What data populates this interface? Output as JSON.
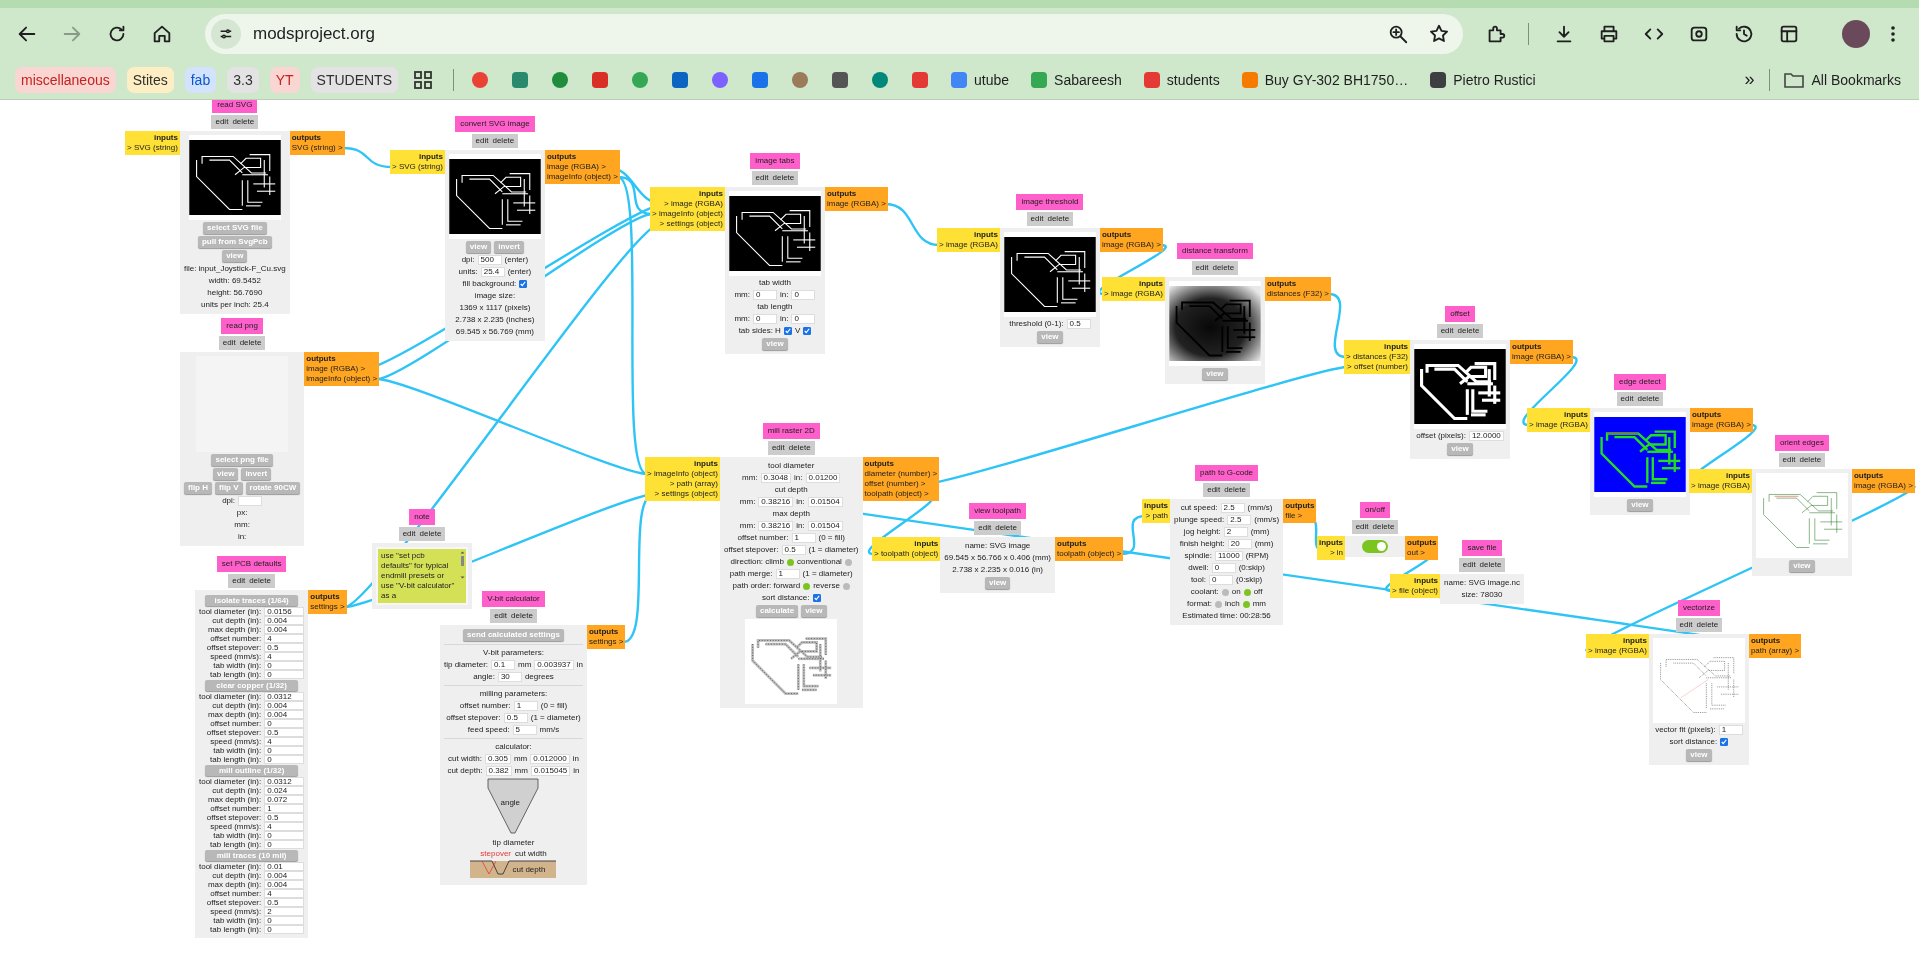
{
  "nav_buttons": [
    {
      "kind": "back",
      "disabled": false
    },
    {
      "kind": "forward",
      "disabled": true
    },
    {
      "kind": "reload",
      "disabled": false
    },
    {
      "kind": "home",
      "disabled": false
    }
  ],
  "address_bar": {
    "url": "modsproject.org"
  },
  "bookmarks": [
    {
      "kind": "chip",
      "label": "miscellaneous",
      "color": "#f9d6d2"
    },
    {
      "kind": "chip",
      "label": "Stites",
      "color": "#fdefc3"
    },
    {
      "kind": "chip",
      "label": "fab",
      "color": "#d3e3fd"
    },
    {
      "kind": "chip",
      "label": "3.3",
      "color": "#e3e3e3"
    },
    {
      "kind": "chip",
      "label": "YT",
      "color": "#f9d6d2"
    },
    {
      "kind": "chip",
      "label": "STUDENTS",
      "color": "#e3e3e3"
    },
    {
      "kind": "apps"
    },
    {
      "kind": "favicon",
      "color": "#ea4335"
    },
    {
      "kind": "favicon",
      "color": "#2b8a6e"
    },
    {
      "kind": "favicon",
      "color": "#1e8e3e"
    },
    {
      "kind": "favicon",
      "color": "#d93025"
    },
    {
      "kind": "favicon",
      "color": "#34a853"
    },
    {
      "kind": "favicon",
      "color": "#0a66c2"
    },
    {
      "kind": "favicon",
      "color": "#7b61ff"
    },
    {
      "kind": "favicon",
      "color": "#1a73e8"
    },
    {
      "kind": "favicon",
      "color": "#9a7b5a"
    },
    {
      "kind": "favicon",
      "color": "#555555"
    },
    {
      "kind": "favicon",
      "color": "#00897b"
    },
    {
      "kind": "favicon",
      "color": "#e53935"
    },
    {
      "kind": "link",
      "label": "utube",
      "color": "#4285f4"
    },
    {
      "kind": "link",
      "label": "Sabareesh",
      "color": "#34a853"
    },
    {
      "kind": "link",
      "label": "students",
      "color": "#e53935"
    },
    {
      "kind": "link",
      "label": "Buy GY-302 BH1750…",
      "color": "#f57c00"
    },
    {
      "kind": "link",
      "label": "Pietro Rustici",
      "color": "#3c4043"
    }
  ],
  "bookmarks_overflow": "»",
  "all_bookmarks": "All Bookmarks",
  "modules": [
    {
      "title": "read SVG",
      "actions": [
        "edit",
        "delete"
      ],
      "inputs": {
        "label": "inputs",
        "ports": [
          "> SVG (string)"
        ]
      },
      "outputs": {
        "label": "outputs",
        "ports": [
          "SVG (string) >"
        ]
      },
      "body": [
        {
          "kind": "pcb_image"
        },
        {
          "kind": "buttons",
          "labels": [
            "select SVG file"
          ]
        },
        {
          "kind": "buttons",
          "labels": [
            "pull from SvgPcb"
          ]
        },
        {
          "kind": "buttons",
          "labels": [
            "view"
          ]
        },
        {
          "kind": "text",
          "text": "file: input_Joystick-F_Cu.svg"
        },
        {
          "kind": "text",
          "text": "width: 69.5452"
        },
        {
          "kind": "text",
          "text": "height: 56.7690"
        },
        {
          "kind": "text",
          "text": "units per inch: 25.4"
        }
      ]
    },
    {
      "title": "read png",
      "actions": [
        "edit",
        "delete"
      ],
      "outputs": {
        "label": "outputs",
        "ports": [
          "image (RGBA) >",
          "imageInfo (object) >"
        ]
      },
      "body": [
        {
          "kind": "blank_image"
        },
        {
          "kind": "buttons",
          "labels": [
            "select png file"
          ]
        },
        {
          "kind": "buttons",
          "labels": [
            "view",
            "invert"
          ]
        },
        {
          "kind": "buttons",
          "labels": [
            "flip H",
            "flip V",
            "rotate 90CW"
          ]
        },
        {
          "kind": "row",
          "parts": [
            {
              "kind": "label",
              "text": "dpi:"
            },
            {
              "kind": "input"
            }
          ]
        },
        {
          "kind": "text",
          "text": "px:"
        },
        {
          "kind": "text",
          "text": "mm:"
        },
        {
          "kind": "text",
          "text": "in:"
        }
      ]
    },
    {
      "title": "set PCB defaults",
      "actions": [
        "edit",
        "delete"
      ],
      "outputs": {
        "label": "outputs",
        "ports": [
          "settings >"
        ]
      },
      "body": [
        {
          "kind": "header_button",
          "label": "isolate traces (1/64)"
        },
        {
          "kind": "row",
          "parts": [
            {
              "kind": "label",
              "text": "tool diameter (in):"
            },
            {
              "kind": "input",
              "value": "0.0156"
            }
          ]
        },
        {
          "kind": "row",
          "parts": [
            {
              "kind": "label",
              "text": "cut depth (in):"
            },
            {
              "kind": "input",
              "value": "0.004"
            }
          ]
        },
        {
          "kind": "row",
          "parts": [
            {
              "kind": "label",
              "text": "max depth (in):"
            },
            {
              "kind": "input",
              "value": "0.004"
            }
          ]
        },
        {
          "kind": "row",
          "parts": [
            {
              "kind": "label",
              "text": "offset number:"
            },
            {
              "kind": "input",
              "value": "4"
            }
          ]
        },
        {
          "kind": "row",
          "parts": [
            {
              "kind": "label",
              "text": "offset stepover:"
            },
            {
              "kind": "input",
              "value": "0.5"
            }
          ]
        },
        {
          "kind": "row",
          "parts": [
            {
              "kind": "label",
              "text": "speed (mm/s):"
            },
            {
              "kind": "input",
              "value": "4"
            }
          ]
        },
        {
          "kind": "row",
          "parts": [
            {
              "kind": "label",
              "text": "tab width (in):"
            },
            {
              "kind": "input",
              "value": "0"
            }
          ]
        },
        {
          "kind": "row",
          "parts": [
            {
              "kind": "label",
              "text": "tab length (in):"
            },
            {
              "kind": "input",
              "value": "0"
            }
          ]
        },
        {
          "kind": "header_button",
          "label": "clear copper (1/32)"
        },
        {
          "kind": "row",
          "parts": [
            {
              "kind": "label",
              "text": "tool diameter (in):"
            },
            {
              "kind": "input",
              "value": "0.0312"
            }
          ]
        },
        {
          "kind": "row",
          "parts": [
            {
              "kind": "label",
              "text": "cut depth (in):"
            },
            {
              "kind": "input",
              "value": "0.004"
            }
          ]
        },
        {
          "kind": "row",
          "parts": [
            {
              "kind": "label",
              "text": "max depth (in):"
            },
            {
              "kind": "input",
              "value": "0.004"
            }
          ]
        },
        {
          "kind": "row",
          "parts": [
            {
              "kind": "label",
              "text": "offset number:"
            },
            {
              "kind": "input",
              "value": "0"
            }
          ]
        },
        {
          "kind": "row",
          "parts": [
            {
              "kind": "label",
              "text": "offset stepover:"
            },
            {
              "kind": "input",
              "value": "0.5"
            }
          ]
        },
        {
          "kind": "row",
          "parts": [
            {
              "kind": "label",
              "text": "speed (mm/s):"
            },
            {
              "kind": "input",
              "value": "4"
            }
          ]
        },
        {
          "kind": "row",
          "parts": [
            {
              "kind": "label",
              "text": "tab width (in):"
            },
            {
              "kind": "input",
              "value": "0"
            }
          ]
        },
        {
          "kind": "row",
          "parts": [
            {
              "kind": "label",
              "text": "tab length (in):"
            },
            {
              "kind": "input",
              "value": "0"
            }
          ]
        },
        {
          "kind": "header_button",
          "label": "mill outline (1/32)"
        },
        {
          "kind": "row",
          "parts": [
            {
              "kind": "label",
              "text": "tool diameter (in):"
            },
            {
              "kind": "input",
              "value": "0.0312"
            }
          ]
        },
        {
          "kind": "row",
          "parts": [
            {
              "kind": "label",
              "text": "cut depth (in):"
            },
            {
              "kind": "input",
              "value": "0.024"
            }
          ]
        },
        {
          "kind": "row",
          "parts": [
            {
              "kind": "label",
              "text": "max depth (in):"
            },
            {
              "kind": "input",
              "value": "0.072"
            }
          ]
        },
        {
          "kind": "row",
          "parts": [
            {
              "kind": "label",
              "text": "offset number:"
            },
            {
              "kind": "input",
              "value": "1"
            }
          ]
        },
        {
          "kind": "row",
          "parts": [
            {
              "kind": "label",
              "text": "offset stepover:"
            },
            {
              "kind": "input",
              "value": "0.5"
            }
          ]
        },
        {
          "kind": "row",
          "parts": [
            {
              "kind": "label",
              "text": "speed (mm/s):"
            },
            {
              "kind": "input",
              "value": "4"
            }
          ]
        },
        {
          "kind": "row",
          "parts": [
            {
              "kind": "label",
              "text": "tab width (in):"
            },
            {
              "kind": "input",
              "value": "0"
            }
          ]
        },
        {
          "kind": "row",
          "parts": [
            {
              "kind": "label",
              "text": "tab length (in):"
            },
            {
              "kind": "input",
              "value": "0"
            }
          ]
        },
        {
          "kind": "header_button",
          "label": "mill traces (10 mil)"
        },
        {
          "kind": "row",
          "parts": [
            {
              "kind": "label",
              "text": "tool diameter (in):"
            },
            {
              "kind": "input",
              "value": "0.01"
            }
          ]
        },
        {
          "kind": "row",
          "parts": [
            {
              "kind": "label",
              "text": "cut depth (in):"
            },
            {
              "kind": "input",
              "value": "0.004"
            }
          ]
        },
        {
          "kind": "row",
          "parts": [
            {
              "kind": "label",
              "text": "max depth (in):"
            },
            {
              "kind": "input",
              "value": "0.004"
            }
          ]
        },
        {
          "kind": "row",
          "parts": [
            {
              "kind": "label",
              "text": "offset number:"
            },
            {
              "kind": "input",
              "value": "4"
            }
          ]
        },
        {
          "kind": "row",
          "parts": [
            {
              "kind": "label",
              "text": "offset stepover:"
            },
            {
              "kind": "input",
              "value": "0.5"
            }
          ]
        },
        {
          "kind": "row",
          "parts": [
            {
              "kind": "label",
              "text": "speed (mm/s):"
            },
            {
              "kind": "input",
              "value": "2"
            }
          ]
        },
        {
          "kind": "row",
          "parts": [
            {
              "kind": "label",
              "text": "tab width (in):"
            },
            {
              "kind": "input",
              "value": "0"
            }
          ]
        },
        {
          "kind": "row",
          "parts": [
            {
              "kind": "label",
              "text": "tab length (in):"
            },
            {
              "kind": "input",
              "value": "0"
            }
          ]
        }
      ]
    },
    {
      "title": "convert SVG image",
      "actions": [
        "edit",
        "delete"
      ],
      "inputs": {
        "label": "inputs",
        "ports": [
          "> SVG (string)"
        ]
      },
      "outputs": {
        "label": "outputs",
        "ports": [
          "image (RGBA) >",
          "imageInfo (object) >"
        ]
      },
      "body": [
        {
          "kind": "pcb_image"
        },
        {
          "kind": "buttons",
          "labels": [
            "view",
            "invert"
          ]
        },
        {
          "kind": "row",
          "parts": [
            {
              "kind": "label",
              "text": "dpi:"
            },
            {
              "kind": "input",
              "value": "500"
            },
            {
              "kind": "label",
              "text": "(enter)"
            }
          ]
        },
        {
          "kind": "row",
          "parts": [
            {
              "kind": "label",
              "text": "units:"
            },
            {
              "kind": "input",
              "value": "25.4"
            },
            {
              "kind": "label",
              "text": "(enter)"
            }
          ]
        },
        {
          "kind": "row",
          "parts": [
            {
              "kind": "label",
              "text": "fill background:"
            },
            {
              "kind": "checkbox",
              "checked": true
            }
          ]
        },
        {
          "kind": "text",
          "text": "image size:"
        },
        {
          "kind": "text",
          "text": "1369 x 1117 (pixels)"
        },
        {
          "kind": "text",
          "text": "2.738 x 2.235 (inches)"
        },
        {
          "kind": "text",
          "text": "69.545 x 56.769 (mm)"
        }
      ]
    },
    {
      "title": "note",
      "actions": [
        "edit",
        "delete"
      ],
      "body": [
        {
          "kind": "textarea",
          "text": "use \"set pcb defaults\" for typical endmill presets or use \"V-bit calculator\" as a"
        }
      ]
    },
    {
      "title": "V-bit calculator",
      "actions": [
        "edit",
        "delete"
      ],
      "outputs": {
        "label": "outputs",
        "ports": [
          "settings >"
        ]
      },
      "body": [
        {
          "kind": "buttons",
          "labels": [
            "send calculated settings"
          ]
        },
        {
          "kind": "rule"
        },
        {
          "kind": "text",
          "text": "V-bit parameters:"
        },
        {
          "kind": "row",
          "parts": [
            {
              "kind": "label",
              "text": "tip diameter:"
            },
            {
              "kind": "input",
              "value": "0.1"
            },
            {
              "kind": "label",
              "text": "mm"
            },
            {
              "kind": "input",
              "value": "0.003937"
            },
            {
              "kind": "label",
              "text": "in"
            }
          ]
        },
        {
          "kind": "row",
          "parts": [
            {
              "kind": "label",
              "text": "angle:"
            },
            {
              "kind": "input",
              "value": "30"
            },
            {
              "kind": "label",
              "text": "degrees"
            }
          ]
        },
        {
          "kind": "rule"
        },
        {
          "kind": "text",
          "text": "milling parameters:"
        },
        {
          "kind": "row",
          "parts": [
            {
              "kind": "label",
              "text": "offset number:"
            },
            {
              "kind": "input",
              "value": "1"
            },
            {
              "kind": "label",
              "text": "(0 = fill)"
            }
          ]
        },
        {
          "kind": "row",
          "parts": [
            {
              "kind": "label",
              "text": "offset stepover:"
            },
            {
              "kind": "input",
              "value": "0.5"
            },
            {
              "kind": "label",
              "text": "(1 = diameter)"
            }
          ]
        },
        {
          "kind": "row",
          "parts": [
            {
              "kind": "label",
              "text": "feed speed:"
            },
            {
              "kind": "input",
              "value": "5"
            },
            {
              "kind": "label",
              "text": "mm/s"
            }
          ]
        },
        {
          "kind": "rule"
        },
        {
          "kind": "text",
          "text": "calculator:"
        },
        {
          "kind": "row",
          "parts": [
            {
              "kind": "label",
              "text": "cut width:"
            },
            {
              "kind": "input",
              "value": "0.305"
            },
            {
              "kind": "label",
              "text": "mm"
            },
            {
              "kind": "input",
              "value": "0.012000"
            },
            {
              "kind": "label",
              "text": "in"
            }
          ]
        },
        {
          "kind": "row",
          "parts": [
            {
              "kind": "label",
              "text": "cut depth:"
            },
            {
              "kind": "input",
              "value": "0.382"
            },
            {
              "kind": "label",
              "text": "mm"
            },
            {
              "kind": "input",
              "value": "0.015045"
            },
            {
              "kind": "label",
              "text": "in"
            }
          ]
        },
        {
          "kind": "vbit",
          "angle_label": "angle",
          "tip_label": "tip diameter",
          "stepover_label": "stepover",
          "width_label": "cut width",
          "depth_label": "cut depth"
        }
      ]
    },
    {
      "title": "image tabs",
      "actions": [
        "edit",
        "delete"
      ],
      "inputs": {
        "label": "inputs",
        "ports": [
          "> image (RGBA)",
          "> imageInfo (object)",
          "> settings (object)"
        ]
      },
      "outputs": {
        "label": "outputs",
        "ports": [
          "image (RGBA) >"
        ]
      },
      "body": [
        {
          "kind": "pcb_image"
        },
        {
          "kind": "text",
          "text": "tab width"
        },
        {
          "kind": "row",
          "parts": [
            {
              "kind": "label",
              "text": "mm:"
            },
            {
              "kind": "input",
              "value": "0"
            },
            {
              "kind": "label",
              "text": "in:"
            },
            {
              "kind": "input",
              "value": "0"
            }
          ]
        },
        {
          "kind": "text",
          "text": "tab length"
        },
        {
          "kind": "row",
          "parts": [
            {
              "kind": "label",
              "text": "mm:"
            },
            {
              "kind": "input",
              "value": "0"
            },
            {
              "kind": "label",
              "text": "in:"
            },
            {
              "kind": "input",
              "value": "0"
            }
          ]
        },
        {
          "kind": "row",
          "parts": [
            {
              "kind": "label",
              "text": "tab sides: H"
            },
            {
              "kind": "checkbox",
              "checked": true
            },
            {
              "kind": "label",
              "text": "V"
            },
            {
              "kind": "checkbox",
              "checked": true
            }
          ]
        },
        {
          "kind": "buttons",
          "labels": [
            "view"
          ]
        }
      ]
    },
    {
      "title": "mill raster 2D",
      "actions": [
        "edit",
        "delete"
      ],
      "inputs": {
        "label": "inputs",
        "ports": [
          "> imageInfo (object)",
          "> path (array)",
          "> settings (object)"
        ]
      },
      "outputs": {
        "label": "outputs",
        "ports": [
          "diameter (number) >",
          "offset (number) >",
          "toolpath (object) >"
        ]
      },
      "body": [
        {
          "kind": "text",
          "text": "tool diameter"
        },
        {
          "kind": "row",
          "parts": [
            {
              "kind": "label",
              "text": "mm:"
            },
            {
              "kind": "input",
              "value": "0.3048"
            },
            {
              "kind": "label",
              "text": "in:"
            },
            {
              "kind": "input",
              "value": "0.01200"
            }
          ]
        },
        {
          "kind": "text",
          "text": "cut depth"
        },
        {
          "kind": "row",
          "parts": [
            {
              "kind": "label",
              "text": "mm:"
            },
            {
              "kind": "input",
              "value": "0.38216"
            },
            {
              "kind": "label",
              "text": "in:"
            },
            {
              "kind": "input",
              "value": "0.01504"
            }
          ]
        },
        {
          "kind": "text",
          "text": "max depth"
        },
        {
          "kind": "row",
          "parts": [
            {
              "kind": "label",
              "text": "mm:"
            },
            {
              "kind": "input",
              "value": "0.38216"
            },
            {
              "kind": "label",
              "text": "in:"
            },
            {
              "kind": "input",
              "value": "0.01504"
            }
          ]
        },
        {
          "kind": "row",
          "parts": [
            {
              "kind": "label",
              "text": "offset number:"
            },
            {
              "kind": "input",
              "value": "1"
            },
            {
              "kind": "label",
              "text": "(0 = fill)"
            }
          ]
        },
        {
          "kind": "row",
          "parts": [
            {
              "kind": "label",
              "text": "offset stepover:"
            },
            {
              "kind": "input",
              "value": "0.5"
            },
            {
              "kind": "label",
              "text": "(1 = diameter)"
            }
          ]
        },
        {
          "kind": "row",
          "parts": [
            {
              "kind": "label",
              "text": "direction: climb"
            },
            {
              "kind": "radio",
              "selected": true
            },
            {
              "kind": "label",
              "text": "conventional"
            },
            {
              "kind": "radio",
              "selected": false
            }
          ]
        },
        {
          "kind": "row",
          "parts": [
            {
              "kind": "label",
              "text": "path merge:"
            },
            {
              "kind": "input",
              "value": "1"
            },
            {
              "kind": "label",
              "text": "(1 = diameter)"
            }
          ]
        },
        {
          "kind": "row",
          "parts": [
            {
              "kind": "label",
              "text": "path order: forward"
            },
            {
              "kind": "radio",
              "selected": true
            },
            {
              "kind": "label",
              "text": "reverse"
            },
            {
              "kind": "radio",
              "selected": false
            }
          ]
        },
        {
          "kind": "row",
          "parts": [
            {
              "kind": "label",
              "text": "sort distance:"
            },
            {
              "kind": "checkbox",
              "checked": true
            }
          ]
        },
        {
          "kind": "buttons",
          "labels": [
            "calculate",
            "view"
          ]
        },
        {
          "kind": "toolpath_image"
        }
      ]
    },
    {
      "title": "image threshold",
      "actions": [
        "edit",
        "delete"
      ],
      "inputs": {
        "label": "inputs",
        "ports": [
          "> image (RGBA)"
        ]
      },
      "outputs": {
        "label": "outputs",
        "ports": [
          "image (RGBA) >"
        ]
      },
      "body": [
        {
          "kind": "pcb_image"
        },
        {
          "kind": "row",
          "parts": [
            {
              "kind": "label",
              "text": "threshold (0-1):"
            },
            {
              "kind": "input",
              "value": "0.5"
            }
          ]
        },
        {
          "kind": "buttons",
          "labels": [
            "view"
          ]
        }
      ]
    },
    {
      "title": "distance transform",
      "actions": [
        "edit",
        "delete"
      ],
      "inputs": {
        "label": "inputs",
        "ports": [
          "> image (RGBA)"
        ]
      },
      "outputs": {
        "label": "outputs",
        "ports": [
          "distances (F32) >"
        ]
      },
      "body": [
        {
          "kind": "distance_image"
        },
        {
          "kind": "buttons",
          "labels": [
            "view"
          ]
        }
      ]
    },
    {
      "title": "view toolpath",
      "actions": [
        "edit",
        "delete"
      ],
      "inputs": {
        "label": "inputs",
        "ports": [
          "> toolpath (object)"
        ]
      },
      "outputs": {
        "label": "outputs",
        "ports": [
          "toolpath (object) >"
        ]
      },
      "body": [
        {
          "kind": "text",
          "text": "name: SVG image"
        },
        {
          "kind": "text",
          "text": "69.545 x 56.766 x 0.406 (mm)"
        },
        {
          "kind": "text",
          "text": "2.738 x 2.235 x 0.016 (in)"
        },
        {
          "kind": "buttons",
          "labels": [
            "view"
          ]
        }
      ]
    },
    {
      "title": "path to G-code",
      "actions": [
        "edit",
        "delete"
      ],
      "inputs": {
        "label": "inputs",
        "ports": [
          "> path"
        ]
      },
      "outputs": {
        "label": "outputs",
        "ports": [
          "file >"
        ]
      },
      "body": [
        {
          "kind": "row",
          "parts": [
            {
              "kind": "label",
              "text": "cut speed:"
            },
            {
              "kind": "input",
              "value": "2.5"
            },
            {
              "kind": "label",
              "text": "(mm/s)"
            }
          ]
        },
        {
          "kind": "row",
          "parts": [
            {
              "kind": "label",
              "text": "plunge speed:"
            },
            {
              "kind": "input",
              "value": "2.5"
            },
            {
              "kind": "label",
              "text": "(mm/s)"
            }
          ]
        },
        {
          "kind": "row",
          "parts": [
            {
              "kind": "label",
              "text": "jog height:"
            },
            {
              "kind": "input",
              "value": "2"
            },
            {
              "kind": "label",
              "text": "(mm)"
            }
          ]
        },
        {
          "kind": "row",
          "parts": [
            {
              "kind": "label",
              "text": "finish height:"
            },
            {
              "kind": "input",
              "value": "20"
            },
            {
              "kind": "label",
              "text": "(mm)"
            }
          ]
        },
        {
          "kind": "row",
          "parts": [
            {
              "kind": "label",
              "text": "spindle:"
            },
            {
              "kind": "input",
              "value": "11000"
            },
            {
              "kind": "label",
              "text": "(RPM)"
            }
          ]
        },
        {
          "kind": "row",
          "parts": [
            {
              "kind": "label",
              "text": "dwell:"
            },
            {
              "kind": "input",
              "value": "0"
            },
            {
              "kind": "label",
              "text": "(0:skip)"
            }
          ]
        },
        {
          "kind": "row",
          "parts": [
            {
              "kind": "label",
              "text": "tool:"
            },
            {
              "kind": "input",
              "value": "0"
            },
            {
              "kind": "label",
              "text": "(0:skip)"
            }
          ]
        },
        {
          "kind": "row",
          "parts": [
            {
              "kind": "label",
              "text": "coolant:"
            },
            {
              "kind": "radio",
              "selected": false
            },
            {
              "kind": "label",
              "text": "on"
            },
            {
              "kind": "radio",
              "selected": true
            },
            {
              "kind": "label",
              "text": "off"
            }
          ]
        },
        {
          "kind": "row",
          "parts": [
            {
              "kind": "label",
              "text": "format:"
            },
            {
              "kind": "radio",
              "selected": false
            },
            {
              "kind": "label",
              "text": "inch"
            },
            {
              "kind": "radio",
              "selected": true
            },
            {
              "kind": "label",
              "text": "mm"
            }
          ]
        },
        {
          "kind": "text",
          "text": "Estimated time: 00:28:56"
        }
      ]
    },
    {
      "title": "offset",
      "actions": [
        "edit",
        "delete"
      ],
      "inputs": {
        "label": "inputs",
        "ports": [
          "> distances (F32)",
          "> offset (number)"
        ]
      },
      "outputs": {
        "label": "outputs",
        "ports": [
          "image (RGBA) >"
        ]
      },
      "body": [
        {
          "kind": "offset_image"
        },
        {
          "kind": "row",
          "parts": [
            {
              "kind": "label",
              "text": "offset (pixels):"
            },
            {
              "kind": "input",
              "value": "12.0000"
            }
          ]
        },
        {
          "kind": "buttons",
          "labels": [
            "view"
          ]
        }
      ]
    },
    {
      "title": "on/off",
      "actions": [
        "edit",
        "delete"
      ],
      "inputs": {
        "label": "inputs",
        "ports": [
          "> in"
        ]
      },
      "outputs": {
        "label": "outputs",
        "ports": [
          "out >"
        ]
      },
      "body": [
        {
          "kind": "toggle",
          "on": true
        }
      ]
    },
    {
      "title": "save file",
      "actions": [
        "edit",
        "delete"
      ],
      "inputs": {
        "label": "inputs",
        "ports": [
          "> file (object)"
        ]
      },
      "body": [
        {
          "kind": "text",
          "text": "name: SVG image.nc"
        },
        {
          "kind": "text",
          "text": "size: 78030"
        }
      ]
    },
    {
      "title": "edge detect",
      "actions": [
        "edit",
        "delete"
      ],
      "inputs": {
        "label": "inputs",
        "ports": [
          "> image (RGBA)"
        ]
      },
      "outputs": {
        "label": "outputs",
        "ports": [
          "image (RGBA) >"
        ]
      },
      "body": [
        {
          "kind": "edge_image"
        },
        {
          "kind": "buttons",
          "labels": [
            "view"
          ]
        }
      ]
    },
    {
      "title": "orient edges",
      "actions": [
        "edit",
        "delete"
      ],
      "inputs": {
        "label": "inputs",
        "ports": [
          "> image (RGBA)"
        ]
      },
      "outputs": {
        "label": "outputs",
        "ports": [
          "image (RGBA) >"
        ]
      },
      "body": [
        {
          "kind": "oriented_image"
        },
        {
          "kind": "buttons",
          "labels": [
            "view"
          ]
        }
      ]
    },
    {
      "title": "vectorize",
      "actions": [
        "edit",
        "delete"
      ],
      "inputs": {
        "label": "inputs",
        "ports": [
          "> image (RGBA)"
        ]
      },
      "outputs": {
        "label": "outputs",
        "ports": [
          "path (array) >"
        ]
      },
      "body": [
        {
          "kind": "vector_image"
        },
        {
          "kind": "row",
          "parts": [
            {
              "kind": "label",
              "text": "vector fit (pixels):"
            },
            {
              "kind": "input",
              "value": "1"
            }
          ]
        },
        {
          "kind": "row",
          "parts": [
            {
              "kind": "label",
              "text": "sort distance:"
            },
            {
              "kind": "checkbox",
              "checked": true
            }
          ]
        },
        {
          "kind": "buttons",
          "labels": [
            "view"
          ]
        }
      ]
    }
  ]
}
